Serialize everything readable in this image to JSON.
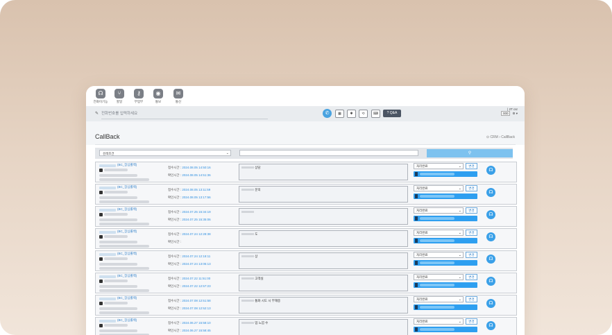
{
  "menu": [
    {
      "label": "전화이기능",
      "icon": "headset-icon",
      "glyph": "☊"
    },
    {
      "label": "할일",
      "icon": "cutlery-icon",
      "glyph": "⑂"
    },
    {
      "label": "부업무",
      "icon": "key-icon",
      "glyph": "⚷"
    },
    {
      "label": "통보",
      "icon": "disc-icon",
      "glyph": "◉"
    },
    {
      "label": "통신",
      "icon": "chat-icon",
      "glyph": "✉"
    }
  ],
  "phonebar": {
    "placeholder": "전화번호를 입력하세요",
    "call_glyph": "✆",
    "controls": [
      "▦",
      "✱",
      "⟲",
      "⌨"
    ],
    "qna_label": "Q&A",
    "user_line": "| 2T csr",
    "status_chip": "000"
  },
  "title": "CallBack",
  "breadcrumb": "⊙ CRM  ›  CallBack",
  "search": {
    "select_label": "검색조건",
    "button_glyph": "⚲"
  },
  "labels": {
    "received": "접수시간 :",
    "confirmed": "확인시간 :",
    "change": "변경",
    "status": "처리완료"
  },
  "rows": [
    {
      "tag": "(BC_장심롤백)",
      "received": "2024.08.05 14:50:16",
      "confirmed": "2024.08.05 14:51:36",
      "memo": "상담"
    },
    {
      "tag": "(BC_장심롤백)",
      "received": "2024.08.05 13:11:59",
      "confirmed": "2024.08.05 13:17:56",
      "memo": "문의"
    },
    {
      "tag": "(BC_장심롤백)",
      "received": "2024.07.25 15:34:19",
      "confirmed": "2024.07.25 15:35:06",
      "memo": ""
    },
    {
      "tag": "(BC_장심롤백)",
      "received": "2024.07.24 12:28:38",
      "confirmed": "",
      "memo": "도"
    },
    {
      "tag": "(BC_장심롤백)",
      "received": "2024.07.24 12:18:11",
      "confirmed": "2024.07.24 13:05:13",
      "memo": "상"
    },
    {
      "tag": "(BC_장심롤백)",
      "received": "2024.07.22 11:51:00",
      "confirmed": "2024.07.22 12:57:23",
      "memo": "고객실"
    },
    {
      "tag": "(BC_장심롤백)",
      "received": "2024.07.08 12:51:58",
      "confirmed": "2024.07.08 12:52:13",
      "memo": "통화 시도 시 부재중"
    },
    {
      "tag": "(BC_장심롤백)",
      "received": "2024.06.27 15:58:10",
      "confirmed": "2024.06.27 15:58:45",
      "memo": "업 느낌 수"
    }
  ]
}
